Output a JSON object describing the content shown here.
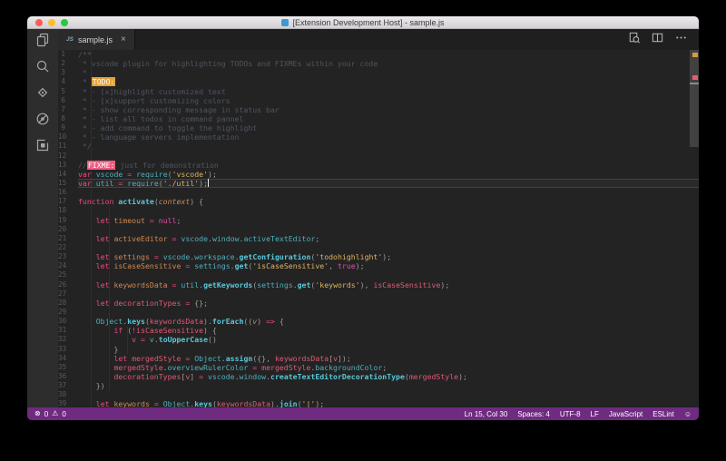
{
  "window": {
    "title": "[Extension Development Host] - sample.js"
  },
  "tab": {
    "label": "sample.js",
    "close_glyph": "×",
    "file_icon": "JS"
  },
  "activity_bar": {
    "items": [
      {
        "name": "explorer",
        "icon": "files-icon"
      },
      {
        "name": "search",
        "icon": "search-icon"
      },
      {
        "name": "source-control",
        "icon": "source-control-icon"
      },
      {
        "name": "debug",
        "icon": "debug-icon"
      },
      {
        "name": "extensions",
        "icon": "extensions-icon"
      }
    ]
  },
  "tab_actions": [
    {
      "name": "open-preview",
      "icon": "preview-icon"
    },
    {
      "name": "split-editor",
      "icon": "split-editor-icon"
    },
    {
      "name": "more-actions",
      "icon": "more-actions-icon"
    }
  ],
  "status_bar": {
    "error_icon": "⊗",
    "error_count": "0",
    "warning_icon": "⚠",
    "warning_count": "0",
    "right_items": [
      "Ln 15, Col 30",
      "Spaces: 4",
      "UTF-8",
      "LF",
      "JavaScript",
      "ESLint"
    ],
    "feedback_icon": "☺"
  },
  "colors": {
    "status_bar_bg": "#6e2b80",
    "editor_bg": "#232324",
    "activity_bar_bg": "#2d2d2e",
    "tab_bar_bg": "#1f1f20",
    "active_tab_bg": "#2b2b2c",
    "keyword": "#f2487e",
    "string": "#ddb362",
    "comment": "#4e555f",
    "variable": "#d0894f",
    "variable_usage": "#e05a72",
    "object": "#4fb0bc",
    "method": "#59c8d8",
    "constant": "#e34fa8",
    "todo_highlight_bg": "#e2a23c",
    "fixme_highlight_bg": "#ee5b80",
    "traffic_red": "#ff5f57",
    "traffic_yellow": "#febc2e",
    "traffic_green": "#28c840"
  },
  "code": {
    "cursor_line": 15,
    "lines": [
      {
        "n": 1,
        "t": [
          [
            "c",
            "/**"
          ]
        ]
      },
      {
        "n": 2,
        "t": [
          [
            "c",
            " * vscode plugin for highlighting TODOs and FIXMEs within your code"
          ]
        ]
      },
      {
        "n": 3,
        "t": [
          [
            "c",
            " *"
          ]
        ]
      },
      {
        "n": 4,
        "t": [
          [
            "c",
            " * "
          ],
          [
            "todo",
            "TODO:"
          ]
        ]
      },
      {
        "n": 5,
        "t": [
          [
            "c",
            " * - [x]highlight customized text"
          ]
        ]
      },
      {
        "n": 6,
        "t": [
          [
            "c",
            " * - [x]support customizing colors"
          ]
        ]
      },
      {
        "n": 7,
        "t": [
          [
            "c",
            " * - show corresponding message in status bar"
          ]
        ]
      },
      {
        "n": 8,
        "t": [
          [
            "c",
            " * - list all todos in command pannel"
          ]
        ]
      },
      {
        "n": 9,
        "t": [
          [
            "c",
            " * - add command to toggle the highlight"
          ]
        ]
      },
      {
        "n": 10,
        "t": [
          [
            "c",
            " * - language servers implementation"
          ]
        ]
      },
      {
        "n": 11,
        "t": [
          [
            "c",
            " */"
          ]
        ]
      },
      {
        "n": 12,
        "t": []
      },
      {
        "n": 13,
        "t": [
          [
            "c",
            "//"
          ],
          [
            "fixme",
            "FIXME:"
          ],
          [
            "c",
            " just for demonstration"
          ]
        ]
      },
      {
        "n": 14,
        "t": [
          [
            "k",
            "var"
          ],
          [
            "w",
            " "
          ],
          [
            "t",
            "vscode"
          ],
          [
            "w",
            " "
          ],
          [
            "k",
            "="
          ],
          [
            "w",
            " "
          ],
          [
            "t",
            "require"
          ],
          [
            "p",
            "("
          ],
          [
            "s",
            "'vscode'"
          ],
          [
            "p",
            ");"
          ]
        ]
      },
      {
        "n": 15,
        "t": [
          [
            "k",
            "var"
          ],
          [
            "w",
            " "
          ],
          [
            "t",
            "util"
          ],
          [
            "w",
            " "
          ],
          [
            "k",
            "="
          ],
          [
            "w",
            " "
          ],
          [
            "t",
            "require"
          ],
          [
            "p",
            "("
          ],
          [
            "s",
            "'./util'"
          ],
          [
            "p",
            ");"
          ]
        ]
      },
      {
        "n": 16,
        "t": []
      },
      {
        "n": 17,
        "t": [
          [
            "k",
            "function"
          ],
          [
            "w",
            " "
          ],
          [
            "m",
            "activate"
          ],
          [
            "p",
            "("
          ],
          [
            "a",
            "context"
          ],
          [
            "p",
            ") {"
          ]
        ]
      },
      {
        "n": 18,
        "t": []
      },
      {
        "n": 19,
        "t": [
          [
            "w",
            "    "
          ],
          [
            "k",
            "let"
          ],
          [
            "w",
            " "
          ],
          [
            "v",
            "timeout"
          ],
          [
            "w",
            " "
          ],
          [
            "k",
            "="
          ],
          [
            "w",
            " "
          ],
          [
            "n",
            "null"
          ],
          [
            "p",
            ";"
          ]
        ]
      },
      {
        "n": 20,
        "t": []
      },
      {
        "n": 21,
        "t": [
          [
            "w",
            "    "
          ],
          [
            "k",
            "let"
          ],
          [
            "w",
            " "
          ],
          [
            "v",
            "activeEditor"
          ],
          [
            "w",
            " "
          ],
          [
            "k",
            "="
          ],
          [
            "w",
            " "
          ],
          [
            "t",
            "vscode"
          ],
          [
            "p",
            "."
          ],
          [
            "t",
            "window"
          ],
          [
            "p",
            "."
          ],
          [
            "t",
            "activeTextEditor"
          ],
          [
            "p",
            ";"
          ]
        ]
      },
      {
        "n": 22,
        "t": []
      },
      {
        "n": 23,
        "t": [
          [
            "w",
            "    "
          ],
          [
            "k",
            "let"
          ],
          [
            "w",
            " "
          ],
          [
            "v",
            "settings"
          ],
          [
            "w",
            " "
          ],
          [
            "k",
            "="
          ],
          [
            "w",
            " "
          ],
          [
            "t",
            "vscode"
          ],
          [
            "p",
            "."
          ],
          [
            "t",
            "workspace"
          ],
          [
            "p",
            "."
          ],
          [
            "m",
            "getConfiguration"
          ],
          [
            "p",
            "("
          ],
          [
            "s",
            "'todohighlight'"
          ],
          [
            "p",
            ");"
          ]
        ]
      },
      {
        "n": 24,
        "t": [
          [
            "w",
            "    "
          ],
          [
            "k",
            "let"
          ],
          [
            "w",
            " "
          ],
          [
            "v",
            "isCaseSensitive"
          ],
          [
            "w",
            " "
          ],
          [
            "k",
            "="
          ],
          [
            "w",
            " "
          ],
          [
            "t",
            "settings"
          ],
          [
            "p",
            "."
          ],
          [
            "m",
            "get"
          ],
          [
            "p",
            "("
          ],
          [
            "s",
            "'isCaseSensitive'"
          ],
          [
            "p",
            ", "
          ],
          [
            "n",
            "true"
          ],
          [
            "p",
            ");"
          ]
        ]
      },
      {
        "n": 25,
        "t": []
      },
      {
        "n": 26,
        "t": [
          [
            "w",
            "    "
          ],
          [
            "k",
            "let"
          ],
          [
            "w",
            " "
          ],
          [
            "v",
            "keywordsData"
          ],
          [
            "w",
            " "
          ],
          [
            "k",
            "="
          ],
          [
            "w",
            " "
          ],
          [
            "t",
            "util"
          ],
          [
            "p",
            "."
          ],
          [
            "m",
            "getKeywords"
          ],
          [
            "p",
            "("
          ],
          [
            "t",
            "settings"
          ],
          [
            "p",
            "."
          ],
          [
            "m",
            "get"
          ],
          [
            "p",
            "("
          ],
          [
            "s",
            "'keywords'"
          ],
          [
            "p",
            "), "
          ],
          [
            "r",
            "isCaseSensitive"
          ],
          [
            "p",
            ");"
          ]
        ]
      },
      {
        "n": 27,
        "t": []
      },
      {
        "n": 28,
        "t": [
          [
            "w",
            "    "
          ],
          [
            "k",
            "let"
          ],
          [
            "w",
            " "
          ],
          [
            "r",
            "decorationTypes"
          ],
          [
            "w",
            " "
          ],
          [
            "k",
            "="
          ],
          [
            "w",
            " "
          ],
          [
            "p",
            "{};"
          ]
        ]
      },
      {
        "n": 29,
        "t": []
      },
      {
        "n": 30,
        "t": [
          [
            "w",
            "    "
          ],
          [
            "t",
            "Object"
          ],
          [
            "p",
            "."
          ],
          [
            "m",
            "keys"
          ],
          [
            "p",
            "("
          ],
          [
            "r",
            "keywordsData"
          ],
          [
            "p",
            ")."
          ],
          [
            "m",
            "forEach"
          ],
          [
            "p",
            "(("
          ],
          [
            "a",
            "v"
          ],
          [
            "p",
            ") "
          ],
          [
            "k",
            "=>"
          ],
          [
            "p",
            " {"
          ]
        ]
      },
      {
        "n": 31,
        "t": [
          [
            "w",
            "        "
          ],
          [
            "k",
            "if"
          ],
          [
            "p",
            " ("
          ],
          [
            "k",
            "!"
          ],
          [
            "r",
            "isCaseSensitive"
          ],
          [
            "p",
            ") {"
          ]
        ]
      },
      {
        "n": 32,
        "t": [
          [
            "w",
            "            "
          ],
          [
            "r",
            "v"
          ],
          [
            "w",
            " "
          ],
          [
            "k",
            "="
          ],
          [
            "w",
            " "
          ],
          [
            "t",
            "v"
          ],
          [
            "p",
            "."
          ],
          [
            "m",
            "toUpperCase"
          ],
          [
            "p",
            "()"
          ]
        ]
      },
      {
        "n": 33,
        "t": [
          [
            "w",
            "        "
          ],
          [
            "p",
            "}"
          ]
        ]
      },
      {
        "n": 34,
        "t": [
          [
            "w",
            "        "
          ],
          [
            "k",
            "let"
          ],
          [
            "w",
            " "
          ],
          [
            "r",
            "mergedStyle"
          ],
          [
            "w",
            " "
          ],
          [
            "k",
            "="
          ],
          [
            "w",
            " "
          ],
          [
            "t",
            "Object"
          ],
          [
            "p",
            "."
          ],
          [
            "m",
            "assign"
          ],
          [
            "p",
            "({}, "
          ],
          [
            "r",
            "keywordsData"
          ],
          [
            "p",
            "["
          ],
          [
            "r",
            "v"
          ],
          [
            "p",
            "]);"
          ]
        ]
      },
      {
        "n": 35,
        "t": [
          [
            "w",
            "        "
          ],
          [
            "r",
            "mergedStyle"
          ],
          [
            "p",
            "."
          ],
          [
            "t",
            "overviewRulerColor"
          ],
          [
            "w",
            " "
          ],
          [
            "k",
            "="
          ],
          [
            "w",
            " "
          ],
          [
            "r",
            "mergedStyle"
          ],
          [
            "p",
            "."
          ],
          [
            "t",
            "backgroundColor"
          ],
          [
            "p",
            ";"
          ]
        ]
      },
      {
        "n": 36,
        "t": [
          [
            "w",
            "        "
          ],
          [
            "r",
            "decorationTypes"
          ],
          [
            "p",
            "["
          ],
          [
            "r",
            "v"
          ],
          [
            "p",
            "] "
          ],
          [
            "k",
            "="
          ],
          [
            "w",
            " "
          ],
          [
            "t",
            "vscode"
          ],
          [
            "p",
            "."
          ],
          [
            "t",
            "window"
          ],
          [
            "p",
            "."
          ],
          [
            "m",
            "createTextEditorDecorationType"
          ],
          [
            "p",
            "("
          ],
          [
            "r",
            "mergedStyle"
          ],
          [
            "p",
            ");"
          ]
        ]
      },
      {
        "n": 37,
        "t": [
          [
            "w",
            "    "
          ],
          [
            "p",
            "})"
          ]
        ]
      },
      {
        "n": 38,
        "t": []
      },
      {
        "n": 39,
        "t": [
          [
            "w",
            "    "
          ],
          [
            "k",
            "let"
          ],
          [
            "w",
            " "
          ],
          [
            "v",
            "keywords"
          ],
          [
            "w",
            " "
          ],
          [
            "k",
            "="
          ],
          [
            "w",
            " "
          ],
          [
            "t",
            "Object"
          ],
          [
            "p",
            "."
          ],
          [
            "m",
            "keys"
          ],
          [
            "p",
            "("
          ],
          [
            "r",
            "keywordsData"
          ],
          [
            "p",
            ")."
          ],
          [
            "m",
            "join"
          ],
          [
            "p",
            "("
          ],
          [
            "s",
            "'|'"
          ],
          [
            "p",
            ");"
          ]
        ]
      }
    ]
  }
}
